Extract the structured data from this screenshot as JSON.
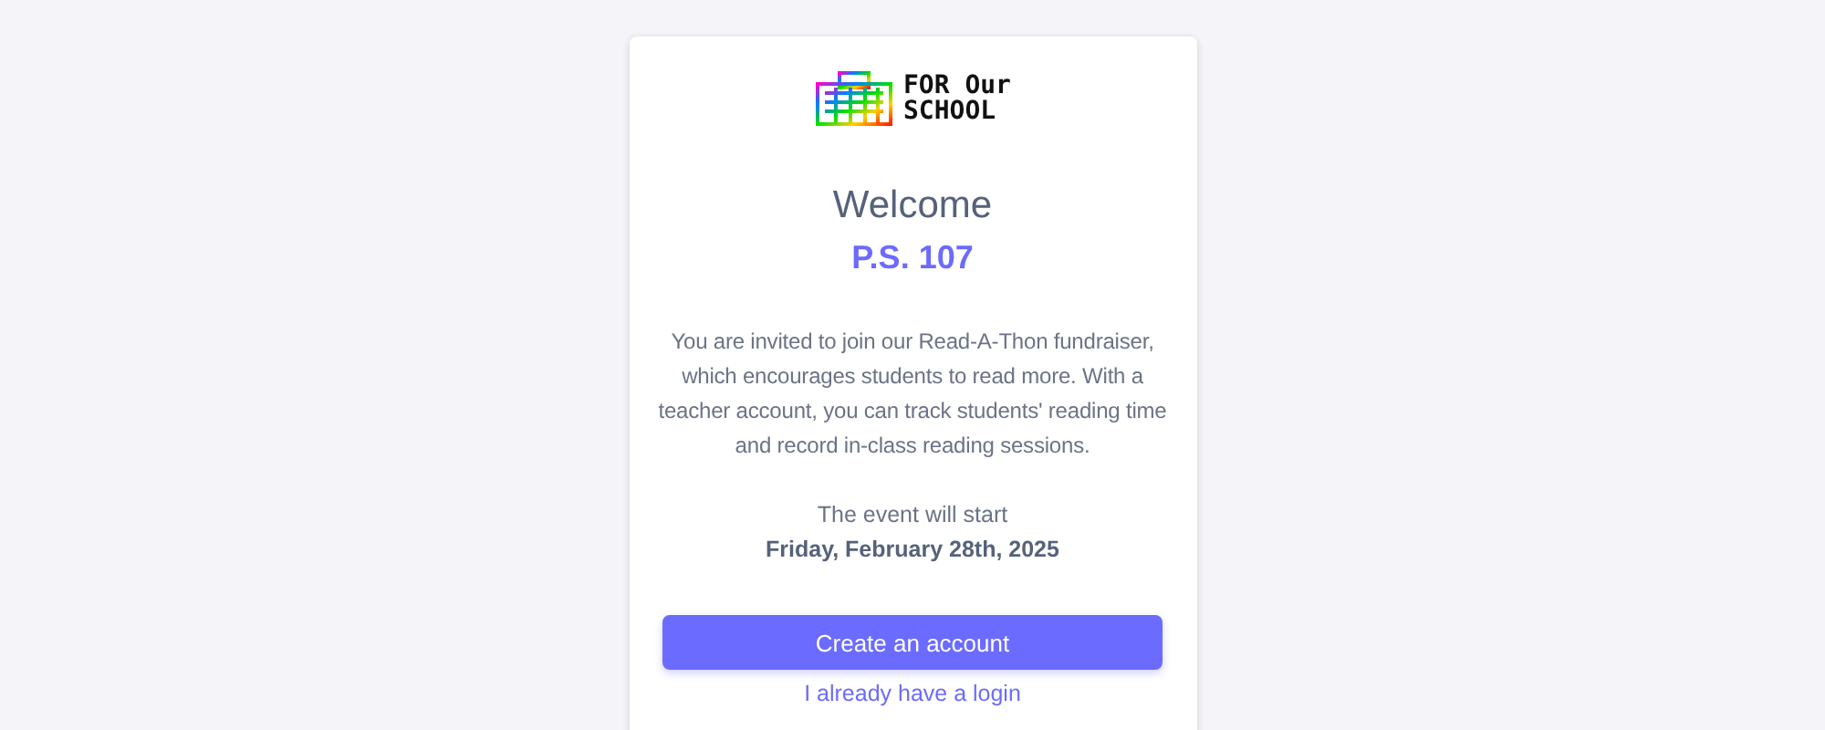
{
  "logo": {
    "lines": [
      "FOR Our",
      "SCHOOL"
    ]
  },
  "welcome": "Welcome",
  "school": "P.S. 107",
  "intro": "You are invited to join our Read-A-Thon fundraiser, which encourages students to read more. With a teacher account, you can track students' reading time and record in-class reading sessions.",
  "event": {
    "label": "The event will start",
    "date": "Friday, February 28th, 2025"
  },
  "primary_button": "Create an account",
  "login_link": "I already have a login"
}
